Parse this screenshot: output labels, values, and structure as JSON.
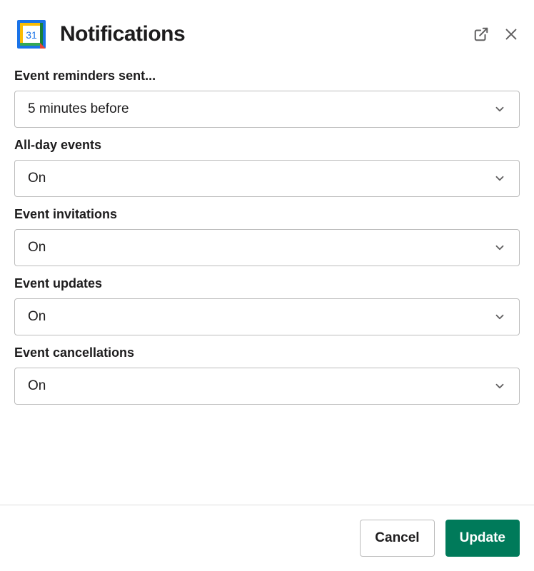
{
  "modal": {
    "title": "Notifications",
    "app_icon_day": "31"
  },
  "fields": {
    "reminders": {
      "label": "Event reminders sent...",
      "value": "5 minutes before"
    },
    "allday": {
      "label": "All-day events",
      "value": "On"
    },
    "invites": {
      "label": "Event invitations",
      "value": "On"
    },
    "updates": {
      "label": "Event updates",
      "value": "On"
    },
    "cancels": {
      "label": "Event cancellations",
      "value": "On"
    }
  },
  "footer": {
    "cancel_label": "Cancel",
    "submit_label": "Update"
  }
}
